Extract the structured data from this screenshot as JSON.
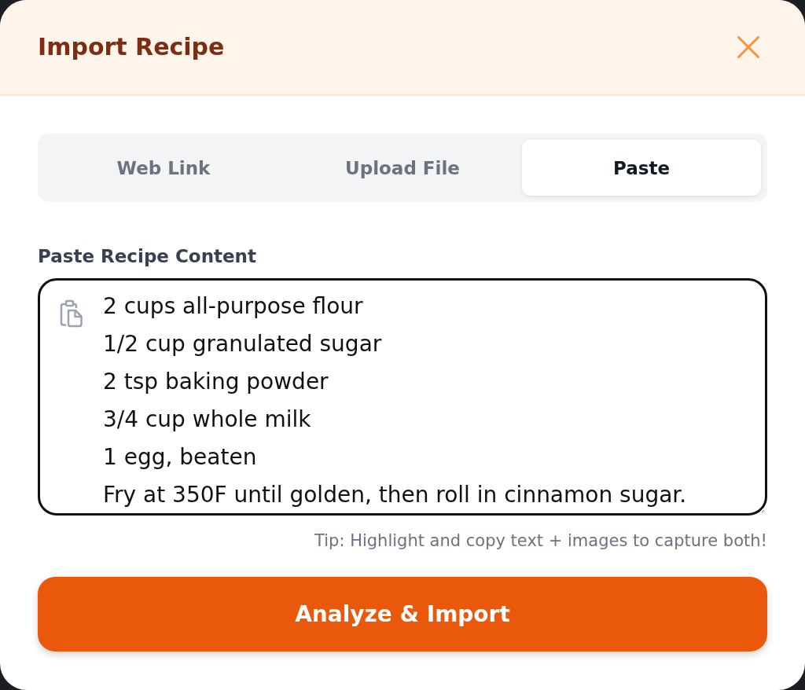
{
  "dialog": {
    "title": "Import Recipe"
  },
  "tabs": [
    {
      "label": "Web Link",
      "selected": false
    },
    {
      "label": "Upload File",
      "selected": false
    },
    {
      "label": "Paste",
      "selected": true
    }
  ],
  "paste_field": {
    "label": "Paste Recipe Content",
    "value": "2 cups all-purpose flour\n1/2 cup granulated sugar\n2 tsp baking powder\n3/4 cup whole milk\n1 egg, beaten\nFry at 350F until golden, then roll in cinnamon sugar.",
    "tip": "Tip: Highlight and copy text + images to capture both!"
  },
  "submit_button": {
    "label": "Analyze & Import"
  }
}
